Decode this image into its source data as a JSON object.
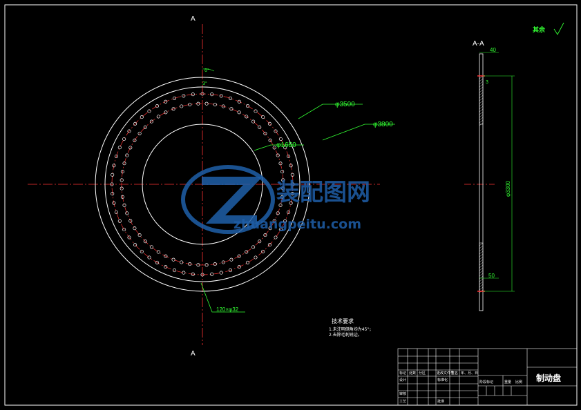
{
  "drawing": {
    "section_mark_top": "A",
    "section_mark_bottom": "A",
    "section_view_label": "A-A",
    "roughness_note": "其余",
    "dimensions": {
      "outer_diameter": "φ3800",
      "mid_diameter": "φ3500",
      "inner_diameter": "φ1650",
      "hole_pattern": "120×φ32",
      "angle_a": "6°",
      "angle_b": "3°",
      "thickness_top": "40",
      "thickness_bottom": "50",
      "section_small": "3",
      "section_height": "φ3300"
    },
    "tech_requirements": {
      "title": "技术要求",
      "items": [
        "1.未注明倒角均为45°；",
        "2.去除毛刺锐边。"
      ]
    },
    "title_block": {
      "part_name": "制动盘",
      "row_labels": [
        "标记",
        "设计",
        "审核",
        "工艺"
      ],
      "col_labels": [
        "处数",
        "分区",
        "更改文件号",
        "签名",
        "年、月、日"
      ],
      "misc_labels": [
        "标准化",
        "批准"
      ],
      "stage_labels": [
        "阶段标记",
        "重量",
        "比例"
      ]
    },
    "watermark": {
      "brand": "装配图网",
      "url": "zhuangpeitu.com"
    }
  }
}
